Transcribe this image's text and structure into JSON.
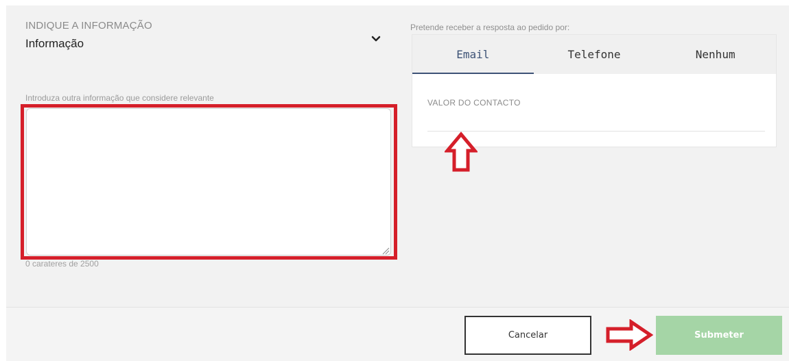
{
  "info_select": {
    "label": "INDIQUE A INFORMAÇÃO",
    "value": "Informação",
    "icon": "chevron-down-icon"
  },
  "notes": {
    "label": "Introduza outra informação que considere relevante",
    "value": "",
    "char_count": "0 carateres de 2500"
  },
  "contact": {
    "label": "Pretende receber a resposta ao pedido por:",
    "tabs": [
      {
        "label": "Email",
        "active": true
      },
      {
        "label": "Telefone",
        "active": false
      },
      {
        "label": "Nenhum",
        "active": false
      }
    ],
    "value_label": "VALOR DO CONTACTO",
    "value": ""
  },
  "actions": {
    "cancel_label": "Cancelar",
    "submit_label": "Submeter"
  },
  "colors": {
    "accent": "#3d5276",
    "highlight": "#d51f2a",
    "submit_disabled": "#a5d5a6"
  }
}
